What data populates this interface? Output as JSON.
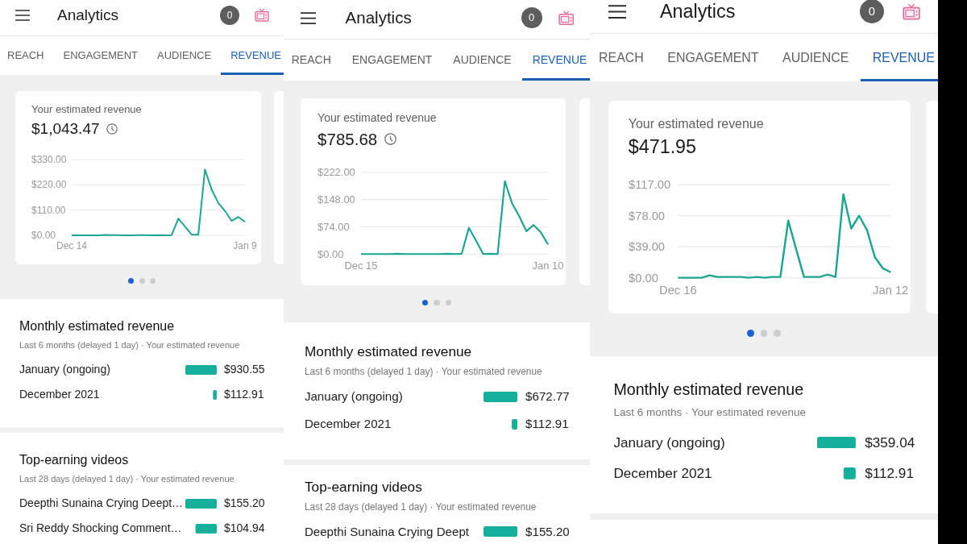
{
  "screens": [
    {
      "header": {
        "title": "Analytics",
        "notification_count": "0"
      },
      "tabs": [
        {
          "label": "REACH",
          "selected": false
        },
        {
          "label": "ENGAGEMENT",
          "selected": false
        },
        {
          "label": "AUDIENCE",
          "selected": false
        },
        {
          "label": "REVENUE",
          "selected": true
        }
      ],
      "revenue_card": {
        "label": "Your estimated revenue",
        "total": "$1,043.47",
        "show_clock": true,
        "chart_data": [
          {
            "type": "line",
            "color": "#1aa690",
            "grid": true,
            "ylim": [
              0,
              330
            ],
            "yticks": [
              {
                "value": 0,
                "label": "$0.00"
              },
              {
                "value": 110,
                "label": "$110.00"
              },
              {
                "value": 220,
                "label": "$220.00"
              },
              {
                "value": 330,
                "label": "$330.00"
              }
            ],
            "categories": [
              "Dec 14",
              null,
              null,
              null,
              null,
              null,
              null,
              null,
              null,
              null,
              null,
              null,
              null,
              null,
              null,
              null,
              null,
              null,
              null,
              null,
              null,
              null,
              null,
              null,
              null,
              null,
              "Jan 9"
            ],
            "values": [
              0,
              0,
              0,
              0,
              0,
              2,
              1,
              1,
              0,
              0,
              1,
              1,
              0,
              1,
              0,
              1,
              73,
              38,
              3,
              3,
              287,
              199,
              141,
              106,
              63,
              80,
              59
            ]
          }
        ]
      },
      "carousel": [
        {
          "selected": true
        },
        {
          "selected": false
        },
        {
          "selected": false
        }
      ],
      "monthly": {
        "title": "Monthly estimated revenue",
        "subtitle": "Last 6 months (delayed 1 day) · Your estimated revenue",
        "chart_data": [
          {
            "type": "bar",
            "orientation": "horizontal",
            "color": "#15b09b",
            "categories": [
              "January (ongoing)",
              "December 2021"
            ],
            "values": [
              930.55,
              112.91
            ],
            "value_labels": [
              "$930.55",
              "$112.91"
            ]
          }
        ]
      },
      "top_videos": {
        "title": "Top-earning videos",
        "subtitle": "Last 28 days (delayed 1 day) · Your estimated revenue",
        "chart_data": [
          {
            "type": "bar",
            "orientation": "horizontal",
            "color": "#15b09b",
            "categories": [
              "Deepthi Sunaina Crying Deept…",
              "Sri Reddy Shocking Comment…"
            ],
            "values": [
              155.2,
              104.94
            ],
            "value_labels": [
              "$155.20",
              "$104.94"
            ]
          }
        ]
      }
    },
    {
      "header": {
        "title": "Analytics",
        "notification_count": "0"
      },
      "tabs": [
        {
          "label": "REACH",
          "selected": false
        },
        {
          "label": "ENGAGEMENT",
          "selected": false
        },
        {
          "label": "AUDIENCE",
          "selected": false
        },
        {
          "label": "REVENUE",
          "selected": true
        }
      ],
      "revenue_card": {
        "label": "Your estimated revenue",
        "total": "$785.68",
        "show_clock": true,
        "chart_data": [
          {
            "type": "line",
            "color": "#1aa690",
            "grid": true,
            "ylim": [
              0,
              222
            ],
            "yticks": [
              {
                "value": 0,
                "label": "$0.00"
              },
              {
                "value": 74,
                "label": "$74.00"
              },
              {
                "value": 148,
                "label": "$148.00"
              },
              {
                "value": 222,
                "label": "$222.00"
              }
            ],
            "categories": [
              "Dec 15",
              null,
              null,
              null,
              null,
              null,
              null,
              null,
              null,
              null,
              null,
              null,
              null,
              null,
              null,
              null,
              null,
              null,
              null,
              null,
              null,
              null,
              null,
              null,
              null,
              null,
              "Jan 10"
            ],
            "values": [
              0,
              0,
              0,
              0,
              0,
              1,
              0,
              0,
              0,
              0,
              0,
              0,
              1,
              0,
              1,
              71,
              36,
              0,
              1,
              0,
              198,
              138,
              103,
              62,
              79,
              59,
              26
            ]
          }
        ]
      },
      "carousel": [
        {
          "selected": true
        },
        {
          "selected": false
        },
        {
          "selected": false
        }
      ],
      "monthly": {
        "title": "Monthly estimated revenue",
        "subtitle": "Last 6 months (delayed 1 day) · Your estimated revenue",
        "chart_data": [
          {
            "type": "bar",
            "orientation": "horizontal",
            "color": "#15b09b",
            "categories": [
              "January (ongoing)",
              "December 2021"
            ],
            "values": [
              672.77,
              112.91
            ],
            "value_labels": [
              "$672.77",
              "$112.91"
            ]
          }
        ]
      },
      "top_videos": {
        "title": "Top-earning videos",
        "subtitle": "Last 28 days (delayed 1 day) · Your estimated revenue",
        "chart_data": [
          {
            "type": "bar",
            "orientation": "horizontal",
            "color": "#15b09b",
            "categories": [
              "Deepthi Sunaina Crying Deept"
            ],
            "values": [
              155.2
            ],
            "value_labels": [
              "$155.20"
            ]
          }
        ]
      }
    },
    {
      "header": {
        "title": "Analytics",
        "notification_count": "0"
      },
      "tabs": [
        {
          "label": "REACH",
          "selected": false
        },
        {
          "label": "ENGAGEMENT",
          "selected": false
        },
        {
          "label": "AUDIENCE",
          "selected": false
        },
        {
          "label": "REVENUE",
          "selected": true
        }
      ],
      "revenue_card": {
        "label": "Your estimated revenue",
        "total": "$471.95",
        "show_clock": false,
        "chart_data": [
          {
            "type": "line",
            "color": "#1aa690",
            "grid": true,
            "ylim": [
              0,
              117
            ],
            "yticks": [
              {
                "value": 0,
                "label": "$0.00"
              },
              {
                "value": 39,
                "label": "$39.00"
              },
              {
                "value": 78,
                "label": "$78.00"
              },
              {
                "value": 117,
                "label": "$117.00"
              }
            ],
            "categories": [
              "Dec 16",
              null,
              null,
              null,
              null,
              null,
              null,
              null,
              null,
              null,
              null,
              null,
              null,
              null,
              null,
              null,
              null,
              null,
              null,
              null,
              null,
              null,
              null,
              null,
              null,
              null,
              null,
              "Jan 12"
            ],
            "values": [
              0,
              0,
              0,
              0,
              3,
              1,
              1,
              1,
              1,
              0,
              1,
              0,
              1,
              1,
              72,
              36,
              1,
              1,
              1,
              4,
              1,
              105,
              62,
              78,
              60,
              26,
              12,
              7
            ]
          }
        ]
      },
      "carousel": [
        {
          "selected": true
        },
        {
          "selected": false
        },
        {
          "selected": false
        }
      ],
      "monthly": {
        "title": "Monthly estimated revenue",
        "subtitle": "Last 6 months · Your estimated revenue",
        "chart_data": [
          {
            "type": "bar",
            "orientation": "horizontal",
            "color": "#15b09b",
            "categories": [
              "January (ongoing)",
              "December 2021"
            ],
            "values": [
              359.04,
              112.91
            ],
            "value_labels": [
              "$359.04",
              "$112.91"
            ]
          }
        ]
      }
    }
  ]
}
